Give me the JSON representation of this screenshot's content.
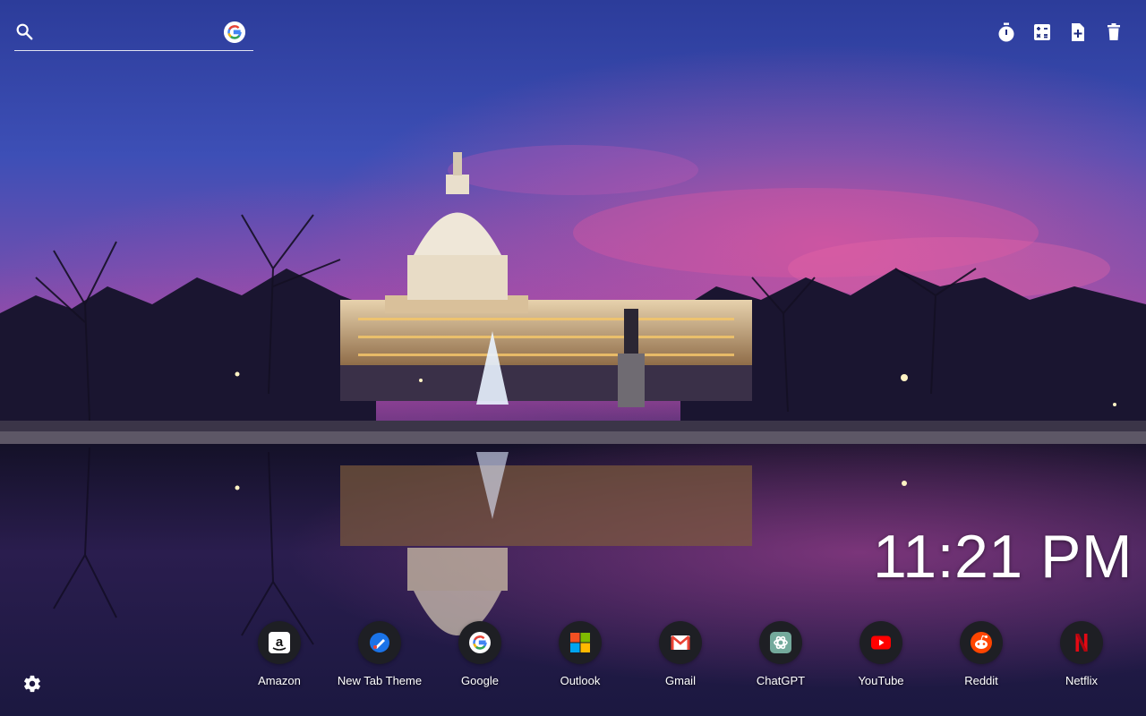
{
  "search": {
    "placeholder": "",
    "engine_icon": "google-icon"
  },
  "toolbar": {
    "items": [
      {
        "name": "timer-icon"
      },
      {
        "name": "calculator-icon"
      },
      {
        "name": "add-note-icon"
      },
      {
        "name": "delete-icon"
      }
    ]
  },
  "clock": {
    "time": "11:21 PM"
  },
  "shortcuts": [
    {
      "label": "Amazon",
      "icon": "amazon-icon"
    },
    {
      "label": "New Tab Theme",
      "icon": "new-tab-theme-icon"
    },
    {
      "label": "Google",
      "icon": "google-icon"
    },
    {
      "label": "Outlook",
      "icon": "outlook-icon"
    },
    {
      "label": "Gmail",
      "icon": "gmail-icon"
    },
    {
      "label": "ChatGPT",
      "icon": "chatgpt-icon"
    },
    {
      "label": "YouTube",
      "icon": "youtube-icon"
    },
    {
      "label": "Reddit",
      "icon": "reddit-icon"
    },
    {
      "label": "Netflix",
      "icon": "netflix-icon"
    }
  ],
  "settings": {
    "icon": "gear-icon"
  },
  "colors": {
    "sky_top": "#2b3f9e",
    "sky_pink": "#c8479a",
    "water": "#130f2b",
    "shortcut_bg": "#1e1f24"
  }
}
